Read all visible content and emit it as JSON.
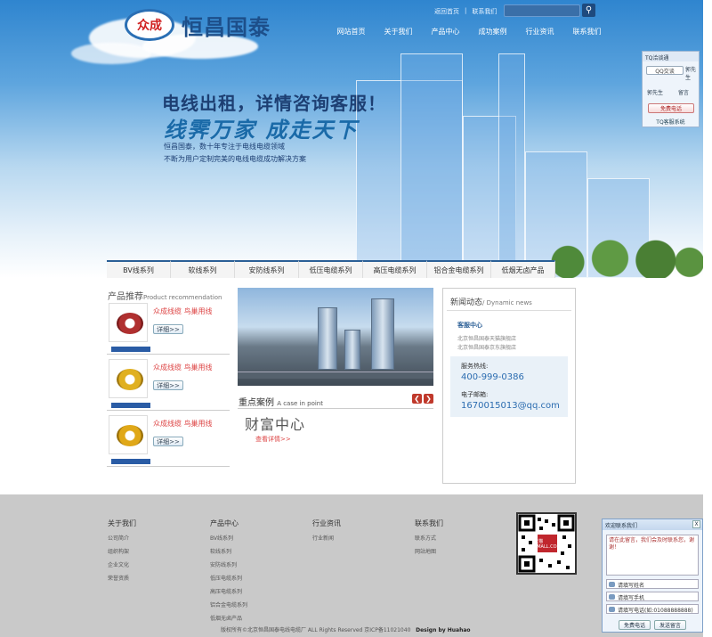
{
  "header": {
    "logo_mark": "众成",
    "logo_text": "恒昌国泰",
    "top_links": [
      "返回首页",
      "|",
      "联系我们"
    ],
    "search_placeholder": "",
    "nav": [
      "网站首页",
      "关于我们",
      "产品中心",
      "成功案例",
      "行业资讯",
      "联系我们"
    ]
  },
  "banner": {
    "slogan_1": "电线出租，详情咨询客服！",
    "slogan_2": "线霁万家  成走天下",
    "desc_1": "恒昌国泰，数十年专注于电线电缆领域",
    "desc_2": "不断为用户定制完美的电线电缆成功解决方案"
  },
  "product_tabs": [
    "BV线系列",
    "软线系列",
    "安防线系列",
    "低压电缆系列",
    "高压电缆系列",
    "铝合金电缆系列",
    "低烟无卤产品"
  ],
  "products": {
    "title": "产品推荐",
    "subtitle": "Product recommendation",
    "items": [
      {
        "name": "众成线缆 鸟巢用线",
        "detail": "详细>>",
        "color": "#b03030"
      },
      {
        "name": "众成线缆 鸟巢用线",
        "detail": "详细>>",
        "color": "#e0b020"
      },
      {
        "name": "众成线缆 鸟巢用线",
        "detail": "详细>>",
        "color": "#e0a818"
      }
    ]
  },
  "case": {
    "title": "重点案例",
    "subtitle": "A case in point",
    "name": "财富中心",
    "more": "查看详情>>"
  },
  "news": {
    "title": "新闻动态",
    "subtitle": "/ Dynamic news",
    "sub_title": "客服中心",
    "items": [
      "北京恒昌国泰天猫旗舰店",
      "北京恒昌国泰京东旗舰店"
    ],
    "hotline_label": "服务热线:",
    "hotline": "400-999-0386",
    "email_label": "电子邮箱:",
    "email": "1670015013@qq.com"
  },
  "footer": {
    "columns": [
      {
        "title": "关于我们",
        "items": [
          "公司简介",
          "组织构架",
          "企业文化",
          "荣誉资质"
        ]
      },
      {
        "title": "产品中心",
        "items": [
          "BV线系列",
          "软线系列",
          "安防线系列",
          "低压电缆系列",
          "高压电缆系列",
          "铝合金电缆系列",
          "低烟无卤产品"
        ]
      },
      {
        "title": "行业资讯",
        "items": [
          "行业新闻"
        ]
      },
      {
        "title": "联系我们",
        "items": [
          "联系方式",
          "网站地图"
        ]
      }
    ],
    "qr_badge": "天猫TMALL.COM",
    "copyright": "版权所有©北京恒昌国泰电线电缆厂 ALL Rights Reserved   京ICP备11021040",
    "design_by": "Design by Huahao"
  },
  "tq_widget": {
    "title": "TQ洽谈通",
    "qq_label": "QQ交谈",
    "agent_1": "郭先生",
    "agent_2": "郭先生",
    "leave_msg": "留言",
    "call_btn": "免费电话",
    "footer": "TQ客服系统"
  },
  "message_widget": {
    "title": "欢迎联系我们",
    "close": "X",
    "text": "请在此留言，我们会及时联系您，谢谢！",
    "name_placeholder": "请填写姓名",
    "phone_placeholder": "请填写手机",
    "tel_placeholder": "请填写电话(如:01088888888)",
    "call_btn": "免费电话",
    "send_btn": "发送留言"
  }
}
